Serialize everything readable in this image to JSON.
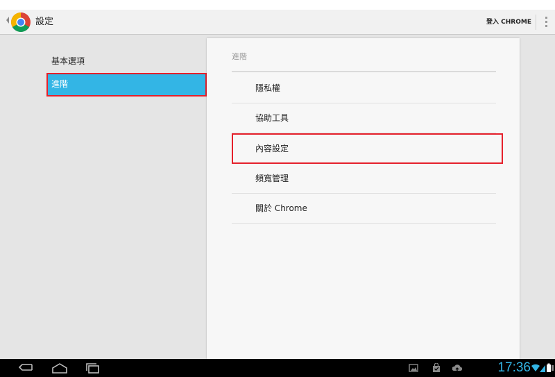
{
  "actionbar": {
    "title": "設定",
    "signin_label": "登入 CHROME",
    "logo_icon": "chrome-logo-icon",
    "overflow_icon": "overflow-menu-icon"
  },
  "left_pane": {
    "items": [
      {
        "label": "基本選項",
        "selected": false
      },
      {
        "label": "進階",
        "selected": true
      }
    ]
  },
  "right_pane": {
    "header": "進階",
    "rows": [
      {
        "label": "隱私權"
      },
      {
        "label": "協助工具"
      },
      {
        "label": "內容設定"
      },
      {
        "label": "頻寬管理"
      },
      {
        "label": "關於 Chrome"
      }
    ]
  },
  "system_bar": {
    "clock": "17:36",
    "nav_icons": [
      "back-icon",
      "home-icon",
      "recent-apps-icon"
    ],
    "status_icons": [
      "screenshot-icon",
      "shopping-bag-icon",
      "upload-icon",
      "wifi-icon",
      "signal-icon",
      "battery-icon"
    ]
  },
  "colors": {
    "accent": "#33b5e5",
    "highlight_border": "#e5202b"
  }
}
